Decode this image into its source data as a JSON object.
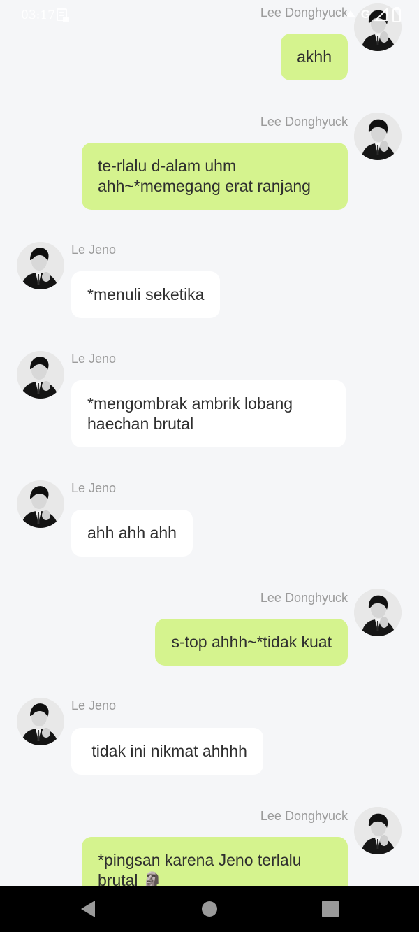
{
  "status_bar": {
    "time": "03:17",
    "network_label": "G",
    "icons": [
      "data-saver-icon",
      "wifi-calling-icon",
      "signal-icon",
      "battery-icon"
    ]
  },
  "chat": {
    "messages": [
      {
        "side": "out",
        "sender": "Lee Donghyuck",
        "text": "akhh"
      },
      {
        "side": "out",
        "sender": "Lee Donghyuck",
        "line1": "te-rlalu d-alam uhm",
        "line2": "ahh~*memegang erat ranjang"
      },
      {
        "side": "in",
        "sender": "Le Jeno",
        "text": "*menuli seketika"
      },
      {
        "side": "in",
        "sender": "Le Jeno",
        "line1": "*mengombrak ambrik lobang",
        "line2": "haechan brutal"
      },
      {
        "side": "in",
        "sender": "Le Jeno",
        "text": "ahh ahh ahh"
      },
      {
        "side": "out",
        "sender": "Lee Donghyuck",
        "text": "s-top ahhh~*tidak kuat"
      },
      {
        "side": "in",
        "sender": "Le Jeno",
        "text": " tidak ini nikmat ahhhh"
      },
      {
        "side": "out",
        "sender": "Lee Donghyuck",
        "line1": "*pingsan karena Jeno terlalu",
        "line2": "brutal 🗿"
      }
    ]
  },
  "nav_bar": {
    "icons": [
      "back-icon",
      "home-icon",
      "recents-icon"
    ]
  },
  "colors": {
    "background": "#f5f6f8",
    "outgoing_bubble": "#d5f38e",
    "incoming_bubble": "#ffffff",
    "sender_text": "#9b9b9b",
    "nav_bar": "#000000"
  }
}
